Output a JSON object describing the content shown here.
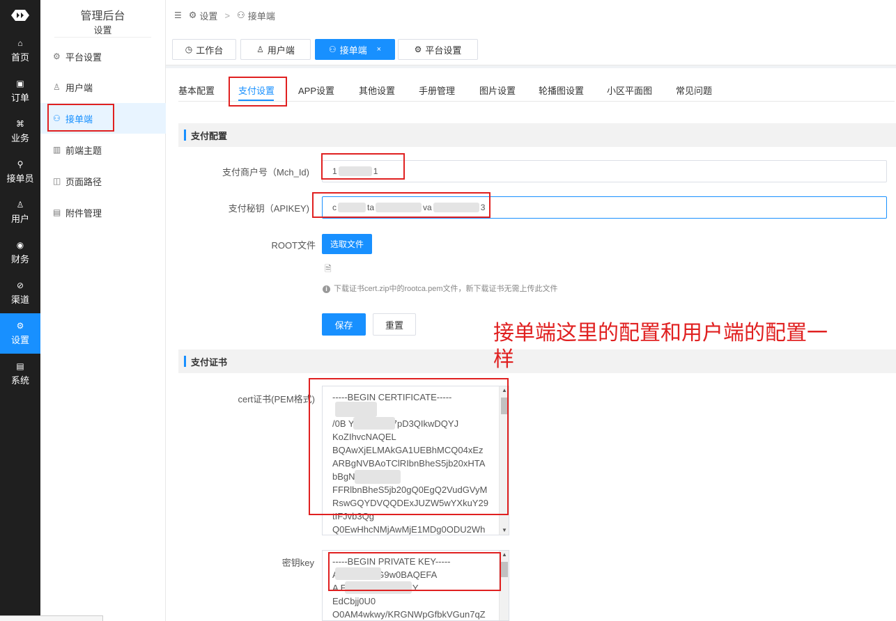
{
  "rail": {
    "items": [
      {
        "label": "首页",
        "icon": "⌂"
      },
      {
        "label": "订单",
        "icon": "▣"
      },
      {
        "label": "业务",
        "icon": "⌘"
      },
      {
        "label": "接单员",
        "icon": "⚲"
      },
      {
        "label": "用户",
        "icon": "♙"
      },
      {
        "label": "财务",
        "icon": "◉"
      },
      {
        "label": "渠道",
        "icon": "⊘"
      },
      {
        "label": "设置",
        "icon": "⚙"
      },
      {
        "label": "系统",
        "icon": "▤"
      }
    ],
    "active_index": 7
  },
  "menu": {
    "title": "管理后台",
    "subtitle": "设置",
    "items": [
      {
        "label": "平台设置",
        "icon": "⚙"
      },
      {
        "label": "用户端",
        "icon": "♙"
      },
      {
        "label": "接单端",
        "icon": "⚇"
      },
      {
        "label": "前端主题",
        "icon": "▥"
      },
      {
        "label": "页面路径",
        "icon": "◫"
      },
      {
        "label": "附件管理",
        "icon": "▤"
      }
    ],
    "active_index": 2
  },
  "breadcrumb": {
    "toggle_icon": "☰",
    "item1": "设置",
    "separator": ">",
    "item2": "接单端"
  },
  "page_tabs": [
    {
      "label": "工作台",
      "icon": "◷"
    },
    {
      "label": "用户端",
      "icon": "♙"
    },
    {
      "label": "接单端",
      "icon": "⚇",
      "close": "×"
    },
    {
      "label": "平台设置",
      "icon": "⚙"
    }
  ],
  "sub_tabs": [
    "基本配置",
    "支付设置",
    "APP设置",
    "其他设置",
    "手册管理",
    "图片设置",
    "轮播图设置",
    "小区平面图",
    "常见问题"
  ],
  "sub_tabs_active": 1,
  "pay_config": {
    "section_title": "支付配置",
    "mch_label": "支付商户号（Mch_Id)",
    "mch_value_start": "1",
    "mch_value_end": "1",
    "apikey_label": "支付秘钥（APIKEY)",
    "apikey_value_a": "c",
    "apikey_value_b": "ta",
    "apikey_value_c": "va",
    "apikey_value_d": "3",
    "root_label": "ROOT文件",
    "select_file_btn": "选取文件",
    "file_icon": "🗎",
    "tip_icon": "i",
    "tip": "下载证书cert.zip中的rootca.pem文件，新下载证书无需上传此文件",
    "save_btn": "保存",
    "reset_btn": "重置"
  },
  "annotation": {
    "line1": "接单端这里的配置和用户端的配置一",
    "line2": "样"
  },
  "pay_cert": {
    "section_title": "支付证书",
    "cert_label": "cert证书(PEM格式)",
    "cert_lines": [
      "-----BEGIN CERTIFICATE-----",
      "",
      "/0B              YXnWxHQ7pD3QIkwDQYJ",
      "KoZIhvcNAQEL",
      "BQAwXjELMAkGA1UEBhMCQ04xEz",
      "ARBgNVBAoTClRIbnBheS5jb20xHTA",
      "bBgN",
      "FFRlbnBheS5jb20gQ0EgQ2VudGVyM",
      "RswGQYDVQQDExJUZW5wYXkuY29",
      "tIFJvb3Qg",
      "Q0EwHhcNMjAwMjE1MDg0ODU2Wh"
    ],
    "key_label": "密钥key",
    "key_lines": [
      "-----BEGIN PRIVATE KEY-----",
      "                 ANBgkqhkiG9w0BAQEFA",
      "A                         EAAoIBAQCWXKY",
      "EdCbjj0U0",
      "O0AM4wkwy/KRGNWpGfbkVGun7qZ"
    ]
  }
}
